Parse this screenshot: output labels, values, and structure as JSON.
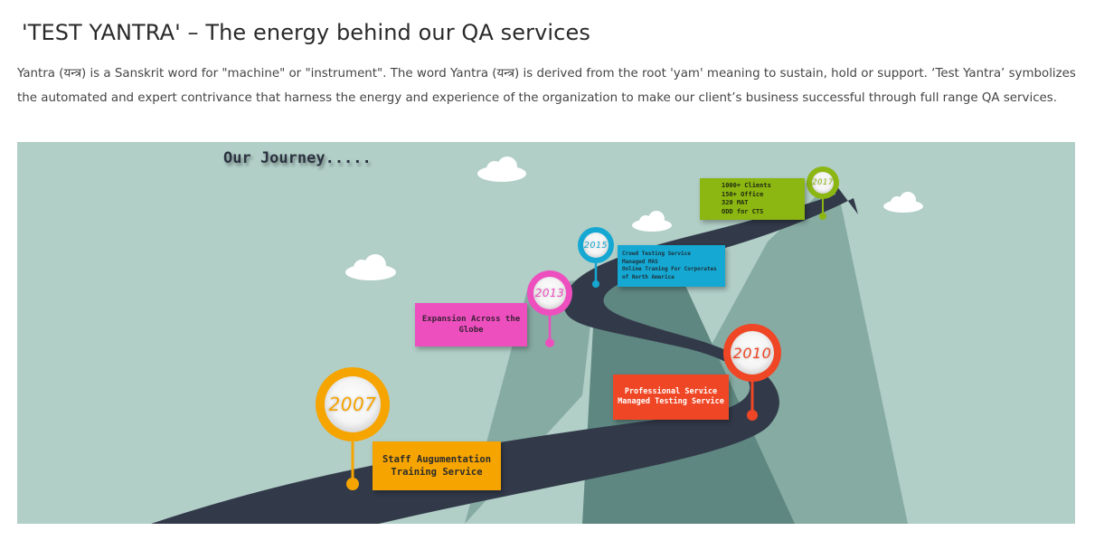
{
  "page": {
    "title": "'TEST YANTRA' – The energy behind our QA services",
    "intro": "Yantra (यन्त्र) is a Sanskrit word for \"machine\" or \"instrument\". The word Yantra (यन्त्र) is derived from the root 'yam' meaning to sustain, hold or support.  ‘Test Yantra’ symbolizes the automated and expert contrivance that harness the energy and experience of the organization to make our client’s business successful through full range QA services."
  },
  "infographic": {
    "title": "Our Journey.....",
    "colors": {
      "background": "#b1cec7",
      "road": "#323a4a",
      "mountain_light": "#86aba2",
      "mountain_dark": "#5f8781",
      "cloud": "#ffffff"
    },
    "milestones": [
      {
        "year": "2007",
        "color": "#f6a400",
        "lines": [
          "Staff Augumentation",
          "Training Service"
        ]
      },
      {
        "year": "2010",
        "color": "#ef4726",
        "lines": [
          "Professional Service",
          "Managed Testing Service"
        ]
      },
      {
        "year": "2013",
        "color": "#ee4fbf",
        "lines": [
          "Expansion Across the",
          "Globe"
        ]
      },
      {
        "year": "2015",
        "color": "#15a8d2",
        "lines": [
          "Crowd Testing Service",
          "Managed MAS",
          "Online Traning For Corporates",
          "of North America"
        ]
      },
      {
        "year": "2017",
        "color": "#8cb612",
        "lines": [
          "1000+ Clients",
          "150+ Office",
          "320 MAT",
          "ODD for CTS"
        ]
      }
    ]
  }
}
